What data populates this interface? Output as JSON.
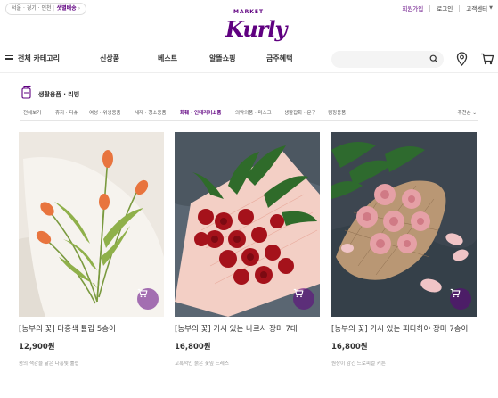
{
  "header": {
    "delivery_regions": "서울 · 경기 · 인천",
    "delivery_badge": "샛별배송",
    "links": {
      "signup": "회원가입",
      "login": "로그인",
      "support": "고객센터"
    },
    "logo": {
      "market": "MARKET",
      "brand": "Kurly"
    },
    "brand_color": "#5f0080"
  },
  "gnb": {
    "category_label": "전체 카테고리",
    "menu": [
      "신상품",
      "베스트",
      "알뜰쇼핑",
      "금주혜택"
    ],
    "search_placeholder": ""
  },
  "category": {
    "title": "생활용품 · 리빙",
    "subtabs": [
      "전체보기",
      "휴지 · 티슈",
      "여성 · 위생용품",
      "세제 · 청소용품",
      "화훼 · 인테리어소품",
      "의약외품 · 마스크",
      "생활잡화 · 문구",
      "캠핑용품"
    ],
    "active_index": 4,
    "sort_label": "추천순"
  },
  "products": [
    {
      "name": "[농부의 꽃] 다홍색 튤립 5송이",
      "price": "12,900원",
      "desc": "봄의 색감을 닮은 다홍빛 튤립",
      "image": "orange-tulips-image"
    },
    {
      "name": "[농부의 꽃] 가시 있는 나르사 장미 7대",
      "price": "16,800원",
      "desc": "고혹적인 붉은 꽃잎 드레스",
      "image": "red-roses-image"
    },
    {
      "name": "[농부의 꽃] 가시 있는 피타하야 장미 7송이",
      "price": "16,800원",
      "desc": "원상이 감긴 드로피컬 커튼",
      "image": "pink-roses-image"
    }
  ]
}
